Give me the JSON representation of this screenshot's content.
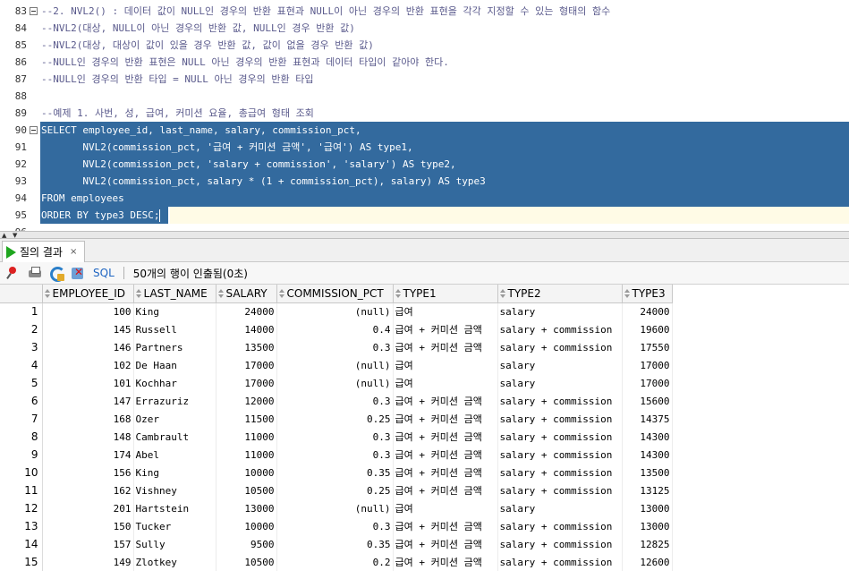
{
  "editor": {
    "lines": [
      {
        "num": "83",
        "text": "--2. NVL2() : 데이터 값이 NULL인 경우의 반환 표현과 NULL이 아닌 경우의 반환 표현을 각각 지정할 수 있는 형태의 함수",
        "type": "comment",
        "fold": true
      },
      {
        "num": "84",
        "text": "--NVL2(대상, NULL이 아닌 경우의 반환 값, NULL인 경우 반환 값)",
        "type": "comment"
      },
      {
        "num": "85",
        "text": "--NVL2(대상, 대상이 값이 있을 경우 반환 값, 값이 없을 경우 반환 값)",
        "type": "comment"
      },
      {
        "num": "86",
        "text": "--NULL인 경우의 반환 표현은 NULL 아닌 경우의 반환 표현과 데이터 타입이 같아야 한다.",
        "type": "comment"
      },
      {
        "num": "87",
        "text": "--NULL인 경우의 반환 타입 = NULL 아닌 경우의 반환 타입",
        "type": "comment"
      },
      {
        "num": "88",
        "text": "",
        "type": "plain"
      },
      {
        "num": "89",
        "text": "--예제 1. 사번, 성, 급여, 커미션 요율, 총급여 형태 조회",
        "type": "comment"
      },
      {
        "num": "90",
        "text": "SELECT employee_id, last_name, salary, commission_pct,",
        "type": "selected",
        "fold": true
      },
      {
        "num": "91",
        "text": "       NVL2(commission_pct, '급여 + 커미션 금액', '급여') AS type1,",
        "type": "selected"
      },
      {
        "num": "92",
        "text": "       NVL2(commission_pct, 'salary + commission', 'salary') AS type2,",
        "type": "selected"
      },
      {
        "num": "93",
        "text": "       NVL2(commission_pct, salary * (1 + commission_pct), salary) AS type3",
        "type": "selected"
      },
      {
        "num": "94",
        "text": "FROM employees",
        "type": "selected"
      },
      {
        "num": "95",
        "text": "ORDER BY type3 DESC;",
        "type": "selected-current"
      },
      {
        "num": "96",
        "text": "",
        "type": "plain"
      }
    ]
  },
  "results": {
    "tab_label": "질의 결과",
    "tab_close": "×",
    "toolbar": {
      "sql_label": "SQL",
      "status": "50개의 행이 인출됨(0초)"
    },
    "columns": [
      "EMPLOYEE_ID",
      "LAST_NAME",
      "SALARY",
      "COMMISSION_PCT",
      "TYPE1",
      "TYPE2",
      "TYPE3"
    ],
    "rows": [
      [
        "1",
        "100",
        "King",
        "24000",
        "(null)",
        "급여",
        "salary",
        "24000"
      ],
      [
        "2",
        "145",
        "Russell",
        "14000",
        "0.4",
        "급여 + 커미션 금액",
        "salary + commission",
        "19600"
      ],
      [
        "3",
        "146",
        "Partners",
        "13500",
        "0.3",
        "급여 + 커미션 금액",
        "salary + commission",
        "17550"
      ],
      [
        "4",
        "102",
        "De Haan",
        "17000",
        "(null)",
        "급여",
        "salary",
        "17000"
      ],
      [
        "5",
        "101",
        "Kochhar",
        "17000",
        "(null)",
        "급여",
        "salary",
        "17000"
      ],
      [
        "6",
        "147",
        "Errazuriz",
        "12000",
        "0.3",
        "급여 + 커미션 금액",
        "salary + commission",
        "15600"
      ],
      [
        "7",
        "168",
        "Ozer",
        "11500",
        "0.25",
        "급여 + 커미션 금액",
        "salary + commission",
        "14375"
      ],
      [
        "8",
        "148",
        "Cambrault",
        "11000",
        "0.3",
        "급여 + 커미션 금액",
        "salary + commission",
        "14300"
      ],
      [
        "9",
        "174",
        "Abel",
        "11000",
        "0.3",
        "급여 + 커미션 금액",
        "salary + commission",
        "14300"
      ],
      [
        "10",
        "156",
        "King",
        "10000",
        "0.35",
        "급여 + 커미션 금액",
        "salary + commission",
        "13500"
      ],
      [
        "11",
        "162",
        "Vishney",
        "10500",
        "0.25",
        "급여 + 커미션 금액",
        "salary + commission",
        "13125"
      ],
      [
        "12",
        "201",
        "Hartstein",
        "13000",
        "(null)",
        "급여",
        "salary",
        "13000"
      ],
      [
        "13",
        "150",
        "Tucker",
        "10000",
        "0.3",
        "급여 + 커미션 금액",
        "salary + commission",
        "13000"
      ],
      [
        "14",
        "157",
        "Sully",
        "9500",
        "0.35",
        "급여 + 커미션 금액",
        "salary + commission",
        "12825"
      ],
      [
        "15",
        "149",
        "Zlotkey",
        "10500",
        "0.2",
        "급여 + 커미션 금액",
        "salary + commission",
        "12600"
      ]
    ]
  },
  "colors": {
    "selection": "#336a9e",
    "comment": "#5a5a8c",
    "run_icon": "#1fa61f",
    "sql_link": "#1f65c2"
  }
}
